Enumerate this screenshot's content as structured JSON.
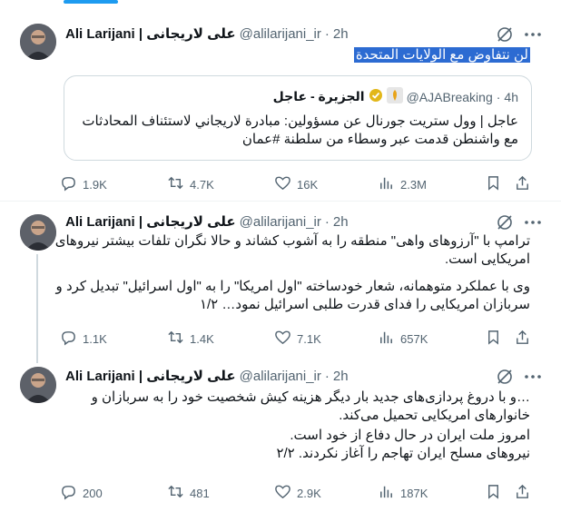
{
  "tweets": [
    {
      "author_name": "Ali Larijani | علی لاریجانی",
      "handle": "@alilarijani_ir",
      "time": "2h",
      "text": "لن نتفاوض مع الولايات المتحدة",
      "quote": {
        "name": "الجزيرة - عاجل",
        "handle": "@AJABreaking",
        "time": "4h",
        "text": "عاجل | وول ستريت جورنال عن مسؤولين: مبادرة لاريجاني لاستئناف المحادثات مع واشنطن قدمت عبر وسطاء من سلطنة #عمان"
      },
      "replies": "1.9K",
      "reposts": "4.7K",
      "likes": "16K",
      "views": "2.3M"
    },
    {
      "author_name": "Ali Larijani | علی لاریجانی",
      "handle": "@alilarijani_ir",
      "time": "2h",
      "text_lines": [
        "ترامپ با \"آرزوهای واهی\" منطقه را به آشوب کشاند و حالا نگران تلفات بیشتر نیروهای امریکایی است.",
        "وی با عملکرد متوهمانه، شعار خودساخته \"اول امریکا\" را به \"اول اسرائیل\" تبدیل کرد و سربازان امریکایی را فدای قدرت طلبی اسرائیل نمود… ۱/۲"
      ],
      "replies": "1.1K",
      "reposts": "1.4K",
      "likes": "7.1K",
      "views": "657K"
    },
    {
      "author_name": "Ali Larijani | علی لاریجانی",
      "handle": "@alilarijani_ir",
      "time": "2h",
      "text_lines": [
        "…و با دروغ پردازی‌های جدید بار دیگر هزینه کیش شخصیت خود را به سربازان و خانوارهای امریکایی تحمیل می‌کند.",
        "امروز ملت ایران در حال دفاع از خود است.",
        "نیروهای مسلح ایران تهاجم را آغاز نکردند. ۲/۲"
      ],
      "replies": "200",
      "reposts": "481",
      "likes": "2.9K",
      "views": "187K"
    }
  ],
  "icons": {
    "grok": "grok-icon",
    "more": "more-icon",
    "reply": "reply-icon",
    "repost": "repost-icon",
    "like": "like-icon",
    "views": "views-icon",
    "bookmark": "bookmark-icon",
    "share": "share-icon"
  },
  "colors": {
    "accent": "#1d9bf0",
    "selection": "#2c6bd2",
    "muted": "#536471"
  }
}
